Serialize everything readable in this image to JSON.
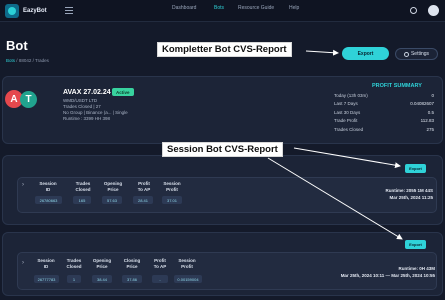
{
  "app": {
    "name": "EazyBot"
  },
  "nav": [
    "Dashboard",
    "Bots",
    "Resource Guide",
    "Help"
  ],
  "nav_active": "Bots",
  "page": {
    "title": "Bot"
  },
  "breadcrumb": {
    "root": "Bots",
    "sep1": "/",
    "id": "88042",
    "sep2": "/",
    "last": "Trades"
  },
  "buttons": {
    "export": "Export",
    "settings": "Settings"
  },
  "annotations": {
    "top": "Kompletter Bot CVS-Report",
    "middle": "Session Bot CVS-Report"
  },
  "bot": {
    "name": "AVAX 27.02.24",
    "status": "Active",
    "line1": "WMD/USDT LTD",
    "line2": "Trades Closed | 27",
    "line3": "No Group | Binance (a... | Single",
    "line4": "Runtime : 3399 HH 398",
    "coin1": "A",
    "coin2": "T"
  },
  "profit_summary": {
    "title": "PROFIT SUMMARY",
    "rows": [
      {
        "label": "Today (13h 03m)",
        "value": "0"
      },
      {
        "label": "Last 7 Days",
        "value": "0.04082607"
      },
      {
        "label": "Last 30 Days",
        "value": "0.5"
      },
      {
        "label": "Trade Profit",
        "value": "112.83"
      },
      {
        "label": "Trades Closed",
        "value": "275"
      }
    ]
  },
  "session1": {
    "export": "Export",
    "headers": [
      "Session\nID",
      "Trades\nClosed",
      "Opening\nPrice",
      "Profit\nTo AP",
      "Session\nProfit"
    ],
    "values": [
      "26780663",
      "165",
      "57.63",
      "28.41",
      "37.01"
    ],
    "runtime1": "Runtime: 2055 1M 44S",
    "runtime2": "Mar 25th, 2024 11:25"
  },
  "session2": {
    "export": "Export",
    "headers": [
      "Session\nID",
      "Trades\nClosed",
      "Opening\nPrice",
      "Closing\nPrice",
      "Profit\nTo AP",
      "Session\nProfit"
    ],
    "values": [
      "26777783",
      "1",
      "38.44",
      "37.86",
      "-",
      "0.00159004"
    ],
    "runtime1": "Runtime: 0H 43M",
    "runtime2": "Mar 25th, 2024 10:11 — Mar 25th, 2024 10:55"
  }
}
